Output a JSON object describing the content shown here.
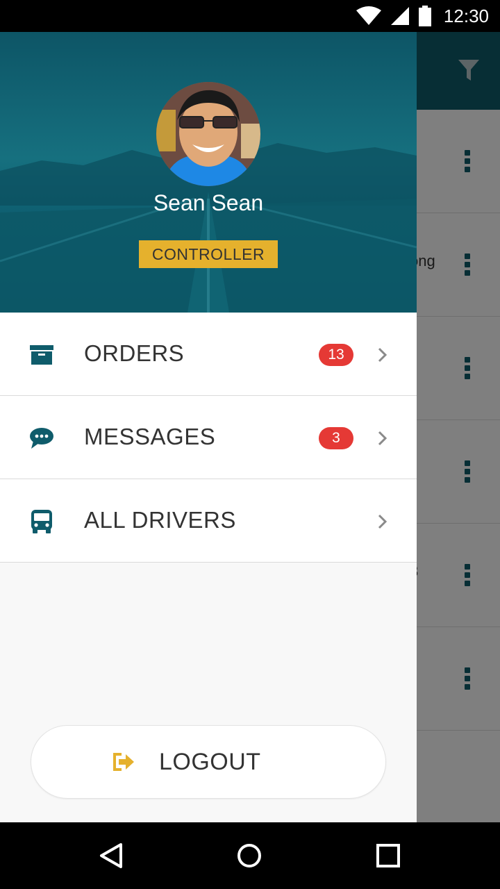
{
  "status_bar": {
    "time": "12:30",
    "icons": [
      "wifi-icon",
      "signal-icon",
      "battery-icon"
    ]
  },
  "background": {
    "toolbar_color": "#0f5c6b",
    "rows": [
      {
        "text": ""
      },
      {
        "text": "ong"
      },
      {
        "text": ""
      },
      {
        "text": ""
      },
      {
        "text": "3"
      },
      {
        "text": ""
      }
    ]
  },
  "drawer": {
    "user": {
      "name": "Sean Sean",
      "role": "CONTROLLER"
    },
    "menu": [
      {
        "label": "ORDERS",
        "badge": "13",
        "icon": "archive-box-icon"
      },
      {
        "label": "MESSAGES",
        "badge": "3",
        "icon": "chat-bubble-icon"
      },
      {
        "label": "ALL DRIVERS",
        "badge": "",
        "icon": "bus-icon"
      }
    ],
    "logout_label": "LOGOUT"
  },
  "colors": {
    "primary": "#0f5c6b",
    "accent": "#e5b12d",
    "badge": "#e53935"
  }
}
